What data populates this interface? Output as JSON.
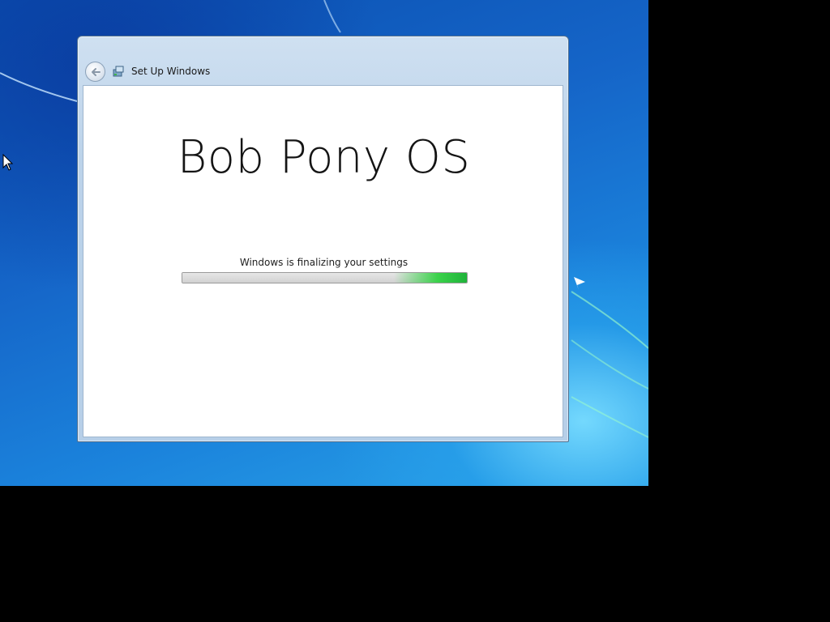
{
  "window": {
    "title": "Set Up Windows"
  },
  "content": {
    "brand_title": "Bob Pony OS",
    "status_text": "Windows is finalizing your settings"
  },
  "progress": {
    "fraction": 1.0,
    "state": "indeterminate"
  },
  "icons": {
    "back": "back-arrow-icon",
    "setup": "windows-setup-icon",
    "cursor": "mouse-pointer-icon"
  },
  "colors": {
    "progress_green": "#3ad24a",
    "window_frame": "#bcd3ea",
    "desktop_blue": "#1565c8"
  }
}
